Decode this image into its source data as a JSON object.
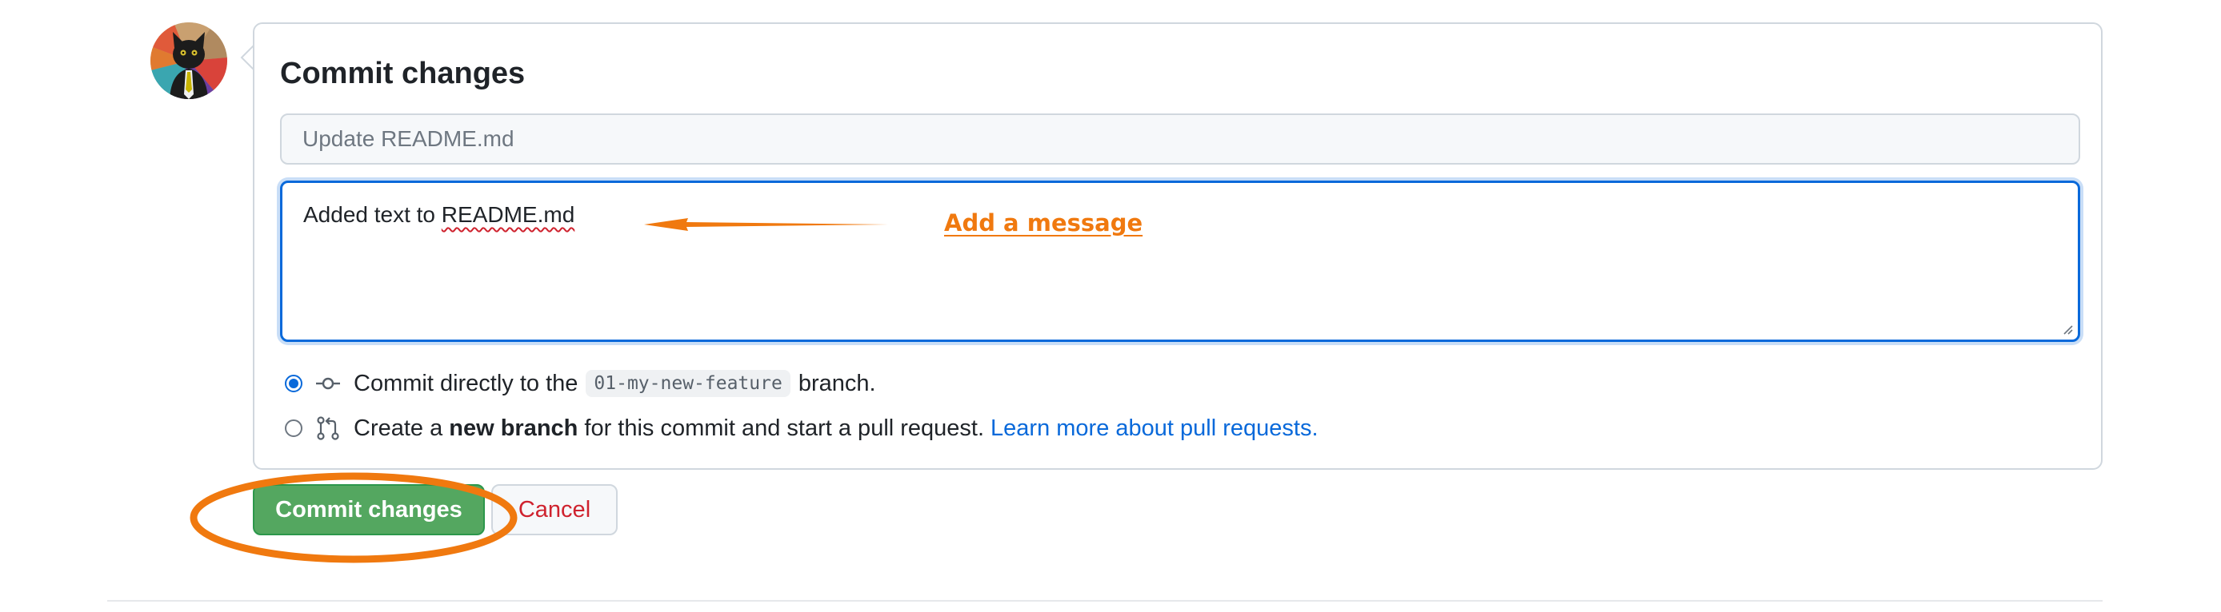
{
  "commit_form": {
    "title": "Commit changes",
    "summary_placeholder": "Update README.md",
    "description_prefix": "Added text to ",
    "description_word": "README.md",
    "options": {
      "direct": {
        "text_before": "Commit directly to the",
        "branch": "01-my-new-feature",
        "text_after": "branch.",
        "checked": true
      },
      "new_branch": {
        "text_before": "Create a",
        "bold": "new branch",
        "text_after": "for this commit and start a pull request.",
        "link": "Learn more about pull requests.",
        "checked": false
      }
    },
    "buttons": {
      "commit": "Commit changes",
      "cancel": "Cancel"
    }
  },
  "annotation": {
    "label": "Add a message",
    "color": "#f0790f"
  },
  "colors": {
    "primary_button": "#54a760",
    "link": "#0969da",
    "cancel_text": "#cf222e",
    "focus_border": "#0969da"
  },
  "icons": [
    "avatar-cat",
    "git-commit-icon",
    "git-pull-request-icon",
    "resize-handle-icon"
  ]
}
